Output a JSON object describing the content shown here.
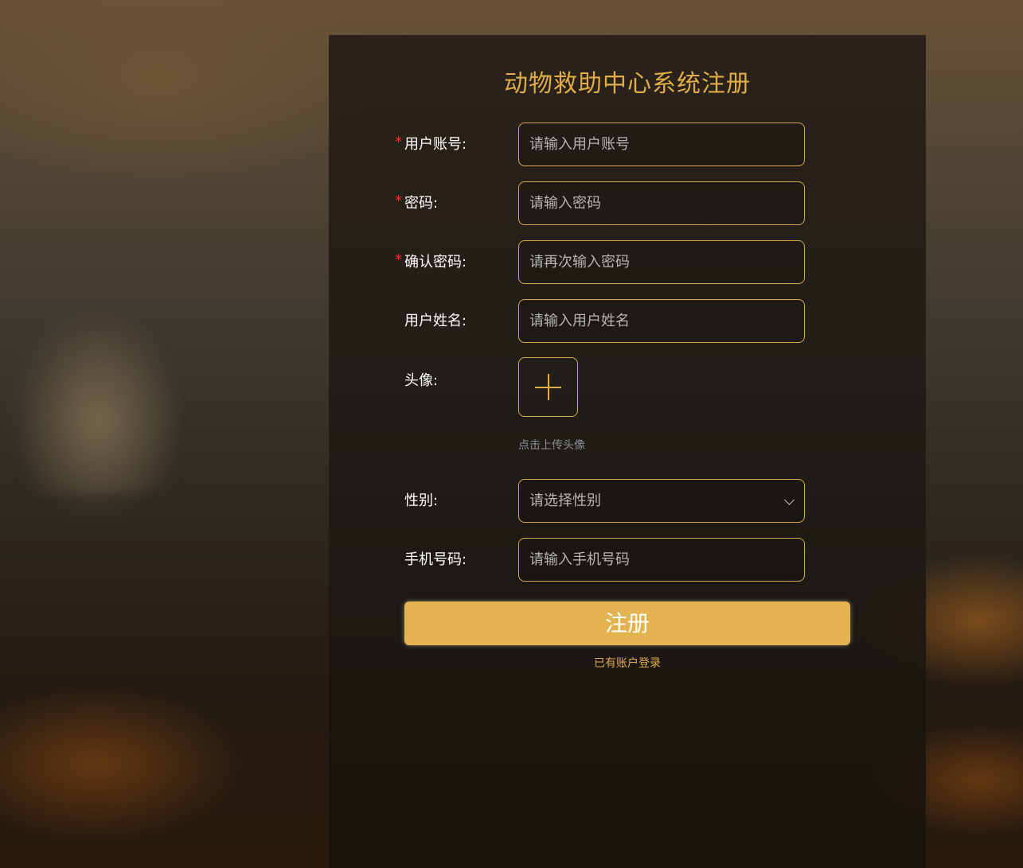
{
  "title": "动物救助中心系统注册",
  "colors": {
    "accent": "#e0ac47",
    "button": "#e2b34f",
    "required": "#ff2a2a",
    "label": "#ffffff",
    "placeholder": "#b4b4b4",
    "hint": "#8b8e96"
  },
  "form": {
    "account": {
      "required_mark": "*",
      "label": "用户账号:",
      "placeholder": "请输入用户账号"
    },
    "password": {
      "required_mark": "*",
      "label": "密码:",
      "placeholder": "请输入密码"
    },
    "confirm_password": {
      "required_mark": "*",
      "label": "确认密码:",
      "placeholder": "请再次输入密码"
    },
    "name": {
      "label": "用户姓名:",
      "placeholder": "请输入用户姓名"
    },
    "avatar": {
      "label": "头像:",
      "upload_icon": "plus-icon",
      "hint": "点击上传头像"
    },
    "gender": {
      "label": "性别:",
      "placeholder": "请选择性别",
      "icon": "chevron-down-icon"
    },
    "phone": {
      "label": "手机号码:",
      "placeholder": "请输入手机号码"
    }
  },
  "submit_label": "注册",
  "login_link": "已有账户登录"
}
